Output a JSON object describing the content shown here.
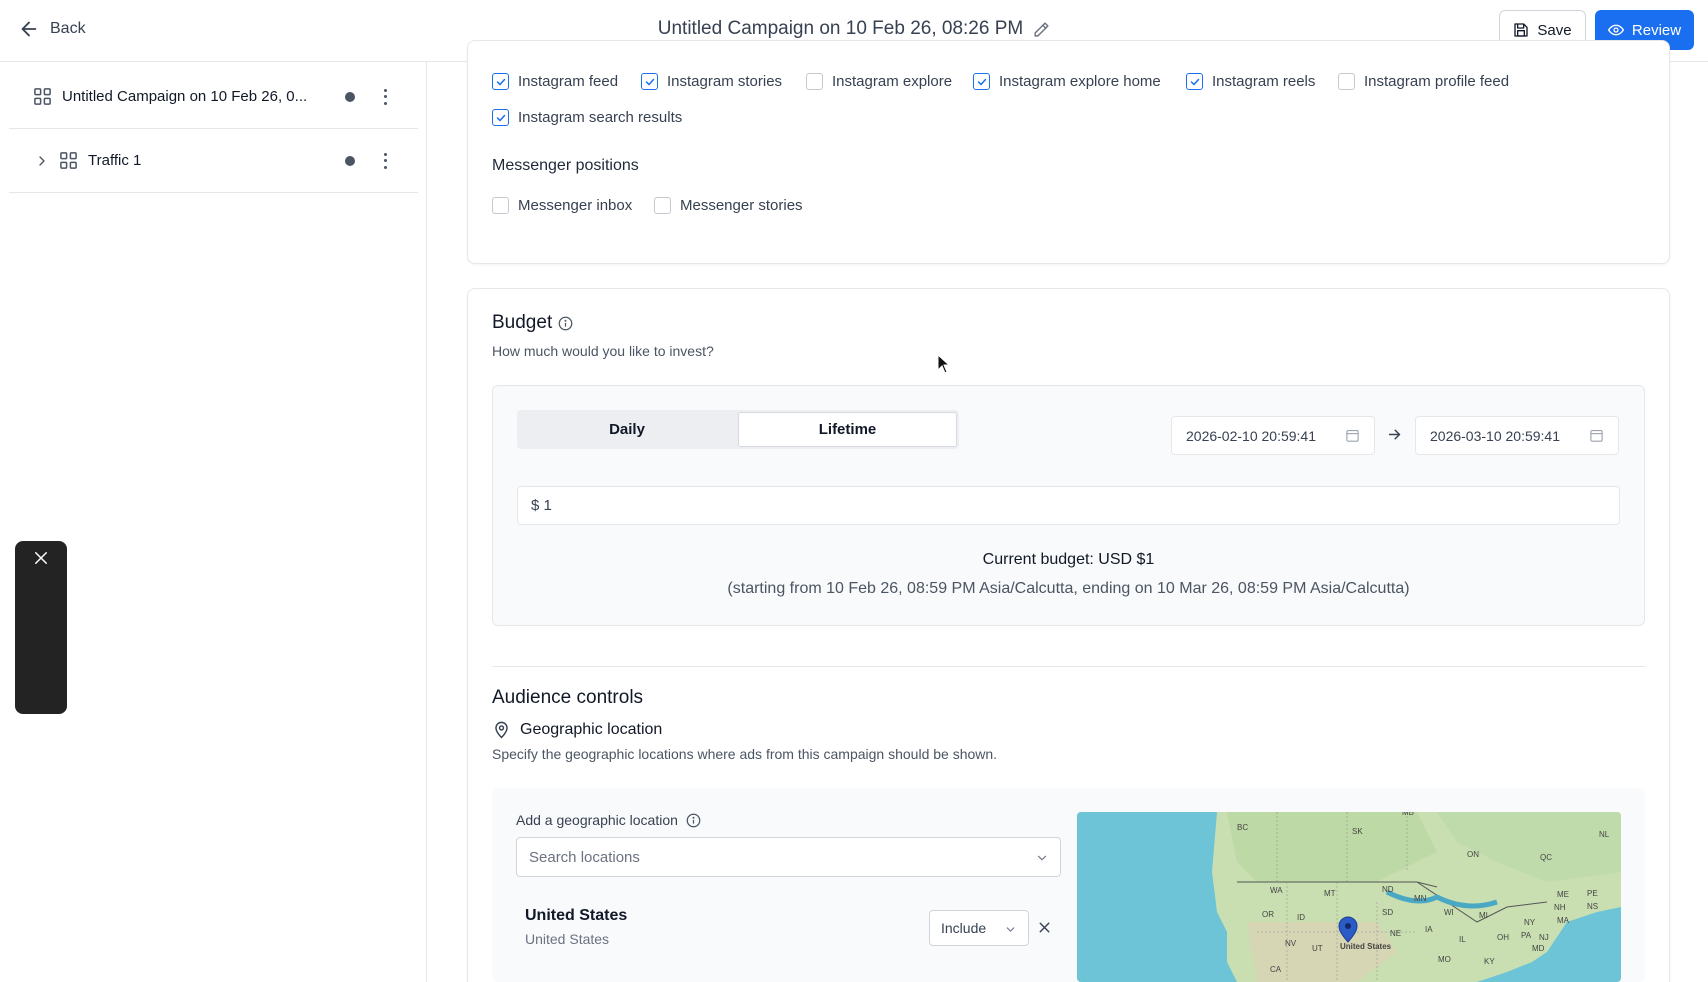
{
  "header": {
    "back_label": "Back",
    "title": "Untitled Campaign on 10 Feb 26, 08:26 PM",
    "save_label": "Save",
    "review_label": "Review",
    "accent_color": "#1a6ff0"
  },
  "sidebar": {
    "items": [
      {
        "label": "Untitled Campaign on 10 Feb 26, 0...",
        "icon": "grid-icon",
        "expandable": false
      },
      {
        "label": "Traffic 1",
        "icon": "grid-icon",
        "expandable": true
      }
    ]
  },
  "placements": {
    "instagram": [
      {
        "label": "Instagram feed",
        "checked": true
      },
      {
        "label": "Instagram stories",
        "checked": true
      },
      {
        "label": "Instagram explore",
        "checked": false
      },
      {
        "label": "Instagram explore home",
        "checked": true
      },
      {
        "label": "Instagram reels",
        "checked": true
      },
      {
        "label": "Instagram profile feed",
        "checked": false
      },
      {
        "label": "Instagram search results",
        "checked": true
      }
    ],
    "messenger_title": "Messenger positions",
    "messenger": [
      {
        "label": "Messenger inbox",
        "checked": false
      },
      {
        "label": "Messenger stories",
        "checked": false
      }
    ]
  },
  "budget": {
    "title": "Budget",
    "subtitle": "How much would you like to invest?",
    "tabs": [
      "Daily",
      "Lifetime"
    ],
    "selected_tab": "Lifetime",
    "start_date": "2026-02-10 20:59:41",
    "end_date": "2026-03-10 20:59:41",
    "amount": "$ 1",
    "current": "Current budget: USD $1",
    "note": "(starting from 10 Feb 26, 08:59 PM Asia/Calcutta, ending on 10 Mar 26, 08:59 PM Asia/Calcutta)"
  },
  "audience": {
    "title": "Audience controls",
    "geo_title": "Geographic location",
    "geo_desc": "Specify the geographic locations where ads from this campaign should be shown.",
    "add_label": "Add a geographic location",
    "search_placeholder": "Search locations",
    "location": {
      "name": "United States",
      "sub": "United States",
      "mode": "Include"
    },
    "map_labels": [
      "BC",
      "SK",
      "MB",
      "NL",
      "QC",
      "ON",
      "WA",
      "MT",
      "ND",
      "MN",
      "ME",
      "PE",
      "NS",
      "OR",
      "ID",
      "SD",
      "WI",
      "MI",
      "NH",
      "NY",
      "MA",
      "NE",
      "IA",
      "NV",
      "UT",
      "United States",
      "IL",
      "OH",
      "PA",
      "CA",
      "MO",
      "KY",
      "NJ",
      "MD"
    ]
  }
}
